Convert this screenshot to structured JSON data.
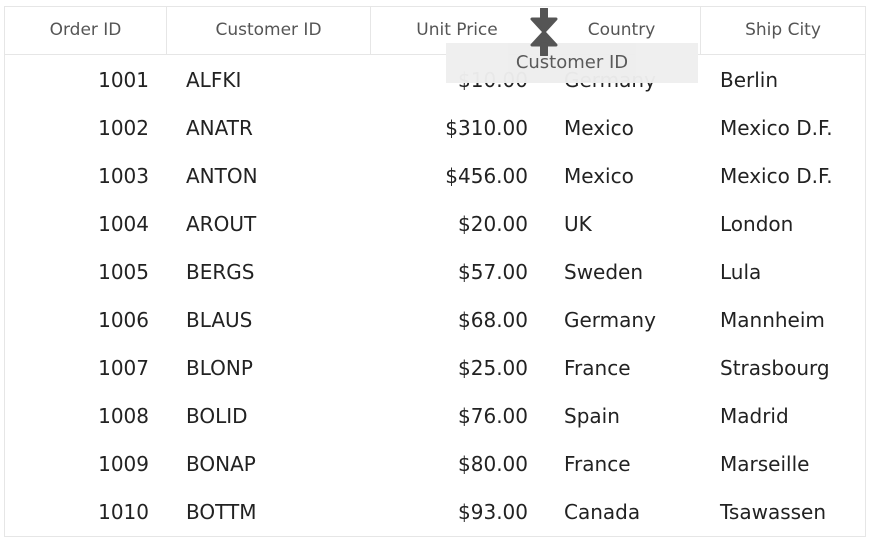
{
  "grid": {
    "columns": [
      "Order ID",
      "Customer ID",
      "Unit Price",
      "Country",
      "Ship City"
    ],
    "rows": [
      {
        "order_id": "1001",
        "customer_id": "ALFKI",
        "unit_price": "$10.00",
        "country": "Germany",
        "ship_city": "Berlin"
      },
      {
        "order_id": "1002",
        "customer_id": "ANATR",
        "unit_price": "$310.00",
        "country": "Mexico",
        "ship_city": "Mexico D.F."
      },
      {
        "order_id": "1003",
        "customer_id": "ANTON",
        "unit_price": "$456.00",
        "country": "Mexico",
        "ship_city": "Mexico D.F."
      },
      {
        "order_id": "1004",
        "customer_id": "AROUT",
        "unit_price": "$20.00",
        "country": "UK",
        "ship_city": "London"
      },
      {
        "order_id": "1005",
        "customer_id": "BERGS",
        "unit_price": "$57.00",
        "country": "Sweden",
        "ship_city": "Lula"
      },
      {
        "order_id": "1006",
        "customer_id": "BLAUS",
        "unit_price": "$68.00",
        "country": "Germany",
        "ship_city": "Mannheim"
      },
      {
        "order_id": "1007",
        "customer_id": "BLONP",
        "unit_price": "$25.00",
        "country": "France",
        "ship_city": "Strasbourg"
      },
      {
        "order_id": "1008",
        "customer_id": "BOLID",
        "unit_price": "$76.00",
        "country": "Spain",
        "ship_city": "Madrid"
      },
      {
        "order_id": "1009",
        "customer_id": "BONAP",
        "unit_price": "$80.00",
        "country": "France",
        "ship_city": "Marseille"
      },
      {
        "order_id": "1010",
        "customer_id": "BOTTM",
        "unit_price": "$93.00",
        "country": "Canada",
        "ship_city": "Tsawassen"
      }
    ]
  },
  "drag": {
    "ghost_label": "Customer ID",
    "indicator_icon": "drop-position-arrows-icon"
  },
  "colors": {
    "border": "#e6e6e6",
    "header_text": "#555555",
    "cell_text": "#222222",
    "ghost_bg": "#eeeeee",
    "indicator": "#555555"
  }
}
